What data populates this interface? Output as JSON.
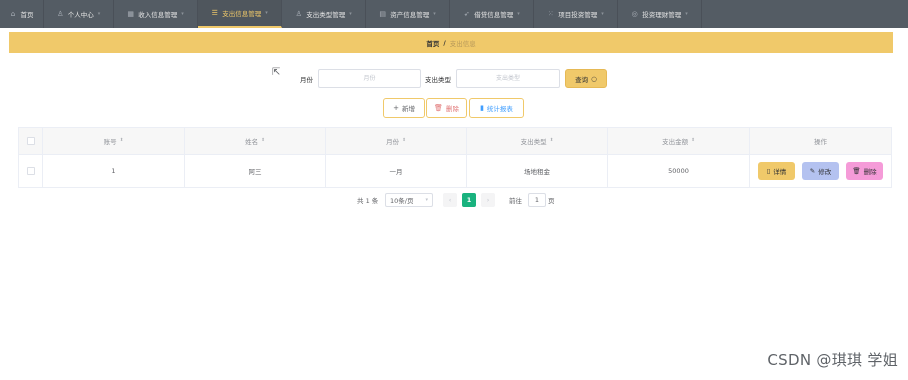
{
  "nav": {
    "items": [
      {
        "label": "首页",
        "icon": "home-icon",
        "glyph": "⌂",
        "caret": false,
        "width": 44,
        "active": false
      },
      {
        "label": "个人中心",
        "icon": "user-icon",
        "glyph": "👤",
        "caret": true,
        "width": 70,
        "active": false
      },
      {
        "label": "收入信息管理",
        "icon": "grid-icon",
        "glyph": "▦",
        "caret": true,
        "width": 84,
        "active": false
      },
      {
        "label": "支出信息管理",
        "icon": "list-icon",
        "glyph": "☰",
        "caret": true,
        "width": 84,
        "active": true
      },
      {
        "label": "支出类型管理",
        "icon": "user-icon",
        "glyph": "👤",
        "caret": true,
        "width": 84,
        "active": false
      },
      {
        "label": "资产信息管理",
        "icon": "card-icon",
        "glyph": "▤",
        "caret": true,
        "width": 84,
        "active": false
      },
      {
        "label": "借贷信息管理",
        "icon": "send-icon",
        "glyph": "➶",
        "caret": true,
        "width": 84,
        "active": false
      },
      {
        "label": "项目投资管理",
        "icon": "apps-icon",
        "glyph": "⁙",
        "caret": true,
        "width": 84,
        "active": false
      },
      {
        "label": "投资理财管理",
        "icon": "circle-icon",
        "glyph": "◎",
        "caret": true,
        "width": 84,
        "active": false
      }
    ]
  },
  "breadcrumb": {
    "home": "首页",
    "separator": "/",
    "current": "支出信息"
  },
  "search": {
    "month_label": "月份",
    "month_placeholder": "月份",
    "type_label": "支出类型",
    "type_placeholder": "支出类型",
    "query_label": "查询"
  },
  "actions": {
    "add": "新增",
    "delete": "删除",
    "report": "统计报表"
  },
  "table": {
    "headers": [
      "账号",
      "姓名",
      "月份",
      "支出类型",
      "支出金额",
      "操作"
    ],
    "rows": [
      {
        "account": "1",
        "name": "阿三",
        "month": "一月",
        "type": "场地租金",
        "amount": "50000"
      }
    ],
    "ops": {
      "detail": "详情",
      "edit": "修改",
      "delete": "删除"
    }
  },
  "pagination": {
    "total": "共 1 条",
    "page_size": "10条/页",
    "current_page": "1",
    "goto_label": "前往",
    "goto_value": "1",
    "page_unit": "页"
  },
  "watermark": "CSDN @琪琪 学姐",
  "colors": {
    "accent": "#f0c96a",
    "nav_bg": "#545c64",
    "page_active": "#19b27e",
    "edit": "#b4c2f0",
    "delete": "#f59bd8"
  }
}
